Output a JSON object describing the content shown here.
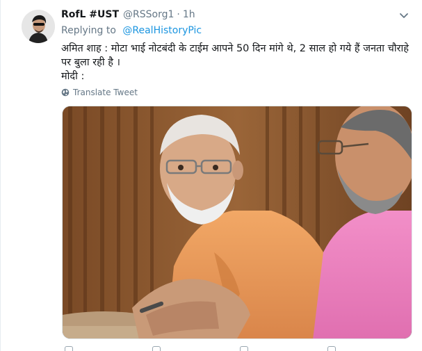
{
  "tweet": {
    "display_name": "RofL #UST",
    "handle": "@RSSorg1",
    "separator": "·",
    "time": "1h",
    "replying_prefix": "Replying to",
    "replying_to": "@RealHistoryPic",
    "text_line1": "अमित शाह : मोटा भाई नोटबंदी के टाईम आपने 50 दिन मांगे थे, 2 साल हो गये हैं जनता चौराहे पर बुला रही है ।",
    "text_line2": "मोदी :",
    "translate_label": "Translate Tweet"
  },
  "icons": {
    "caret": "chevron-down-icon",
    "translate": "globe-icon",
    "media": "photo"
  },
  "colors": {
    "link": "#1b95e0",
    "secondary": "#657786",
    "text": "#14171a"
  }
}
